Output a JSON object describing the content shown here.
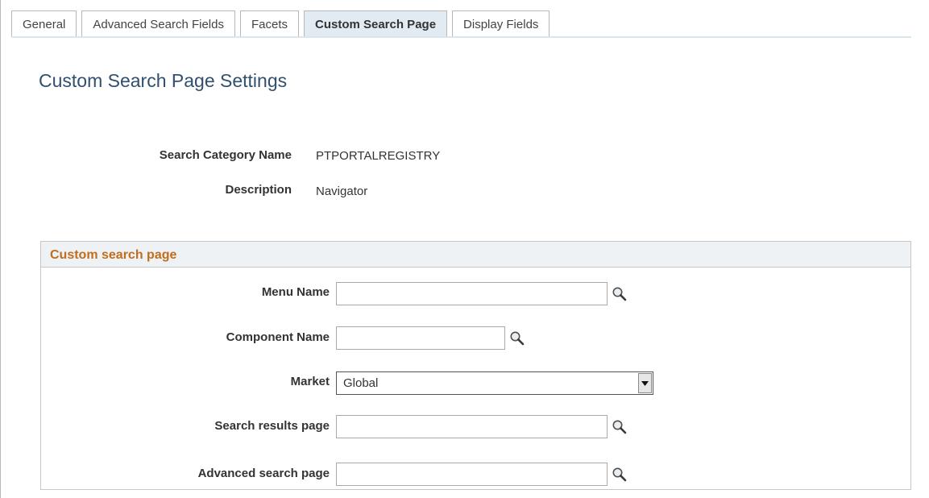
{
  "tabs": [
    {
      "label": "General"
    },
    {
      "label": "Advanced Search Fields"
    },
    {
      "label": "Facets"
    },
    {
      "label": "Custom Search Page",
      "active": true
    },
    {
      "label": "Display Fields"
    }
  ],
  "page_title": "Custom Search Page Settings",
  "info": {
    "category_label": "Search Category Name",
    "category_value": "PTPORTALREGISTRY",
    "description_label": "Description",
    "description_value": "Navigator"
  },
  "group": {
    "title": "Custom search page",
    "menu_name": {
      "label": "Menu Name",
      "value": ""
    },
    "component_name": {
      "label": "Component Name",
      "value": ""
    },
    "market": {
      "label": "Market",
      "value": "Global"
    },
    "search_results_page": {
      "label": "Search results page",
      "value": ""
    },
    "advanced_search_page": {
      "label": "Advanced search page",
      "value": ""
    }
  },
  "colors": {
    "title": "#314f6e",
    "group_title": "#c26d1c",
    "active_tab_bg": "#e3ebf2",
    "group_header_bg": "#eef2f5"
  },
  "icons": {
    "lookup": "magnifier-icon",
    "dropdown": "triangle-down-icon"
  }
}
